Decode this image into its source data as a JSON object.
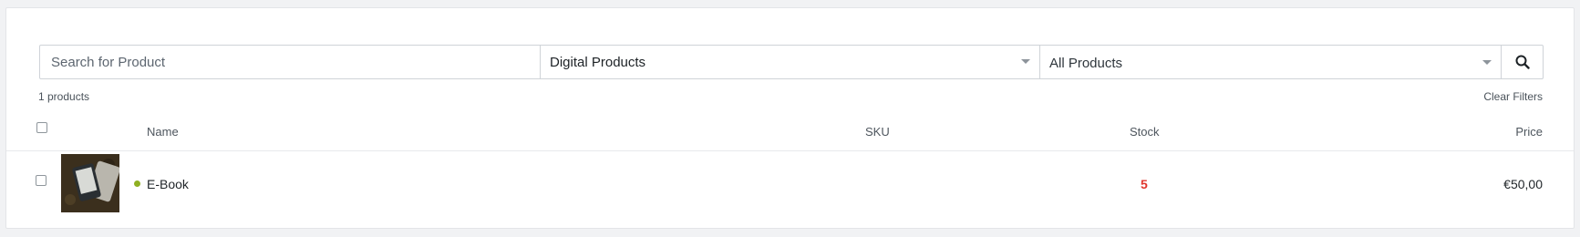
{
  "filters": {
    "search_placeholder": "Search for Product",
    "category_value": "Digital Products",
    "scope_value": "All Products"
  },
  "summary": {
    "count_label": "1 products",
    "clear_label": "Clear Filters"
  },
  "table": {
    "headers": {
      "name": "Name",
      "sku": "SKU",
      "stock": "Stock",
      "price": "Price"
    },
    "rows": [
      {
        "name": "E-Book",
        "sku": "",
        "stock": "5",
        "price": "€50,00",
        "status_color": "#8fb022"
      }
    ]
  },
  "colors": {
    "stock_low": "#e0352d",
    "status_active": "#8fb022"
  }
}
